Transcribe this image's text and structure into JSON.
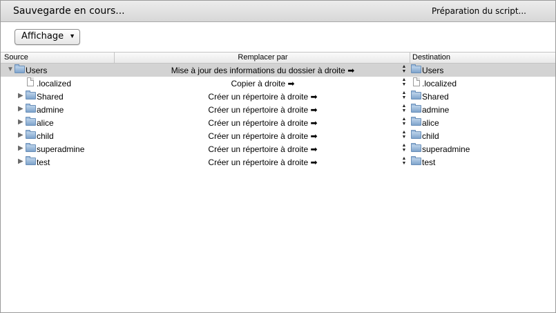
{
  "window": {
    "title": "Sauvegarde en cours...",
    "status": "Préparation du script..."
  },
  "toolbar": {
    "view_popup_label": "Affichage"
  },
  "columns": {
    "source": "Source",
    "action": "Remplacer par",
    "destination": "Destination"
  },
  "rows": [
    {
      "source": "Users",
      "action": "Mise à jour des informations du dossier à droite ➡",
      "destination": "Users",
      "type": "folder",
      "expanded": true,
      "selected": true
    },
    {
      "source": ".localized",
      "action": "Copier à droite ➡",
      "destination": ".localized",
      "type": "file"
    },
    {
      "source": "Shared",
      "action": "Créer un répertoire à droite ➡",
      "destination": "Shared",
      "type": "folder"
    },
    {
      "source": "admine",
      "action": "Créer un répertoire à droite ➡",
      "destination": "admine",
      "type": "folder"
    },
    {
      "source": "alice",
      "action": "Créer un répertoire à droite ➡",
      "destination": "alice",
      "type": "folder"
    },
    {
      "source": "child",
      "action": "Créer un répertoire à droite ➡",
      "destination": "child",
      "type": "folder"
    },
    {
      "source": "superadmine",
      "action": "Créer un répertoire à droite ➡",
      "destination": "superadmine",
      "type": "folder"
    },
    {
      "source": "test",
      "action": "Créer un répertoire à droite ➡",
      "destination": "test",
      "type": "folder"
    }
  ],
  "icons": {
    "folder": "folder-icon",
    "file": "document-icon",
    "disclosure_open": "disclosure-triangle-down-icon",
    "disclosure_closed": "disclosure-triangle-right-icon",
    "stepper": "stepper-arrows-icon",
    "popup_arrow": "chevron-down-icon"
  },
  "colors": {
    "selected_row": "#d3d3d3",
    "folder": "#7fa4cc"
  }
}
